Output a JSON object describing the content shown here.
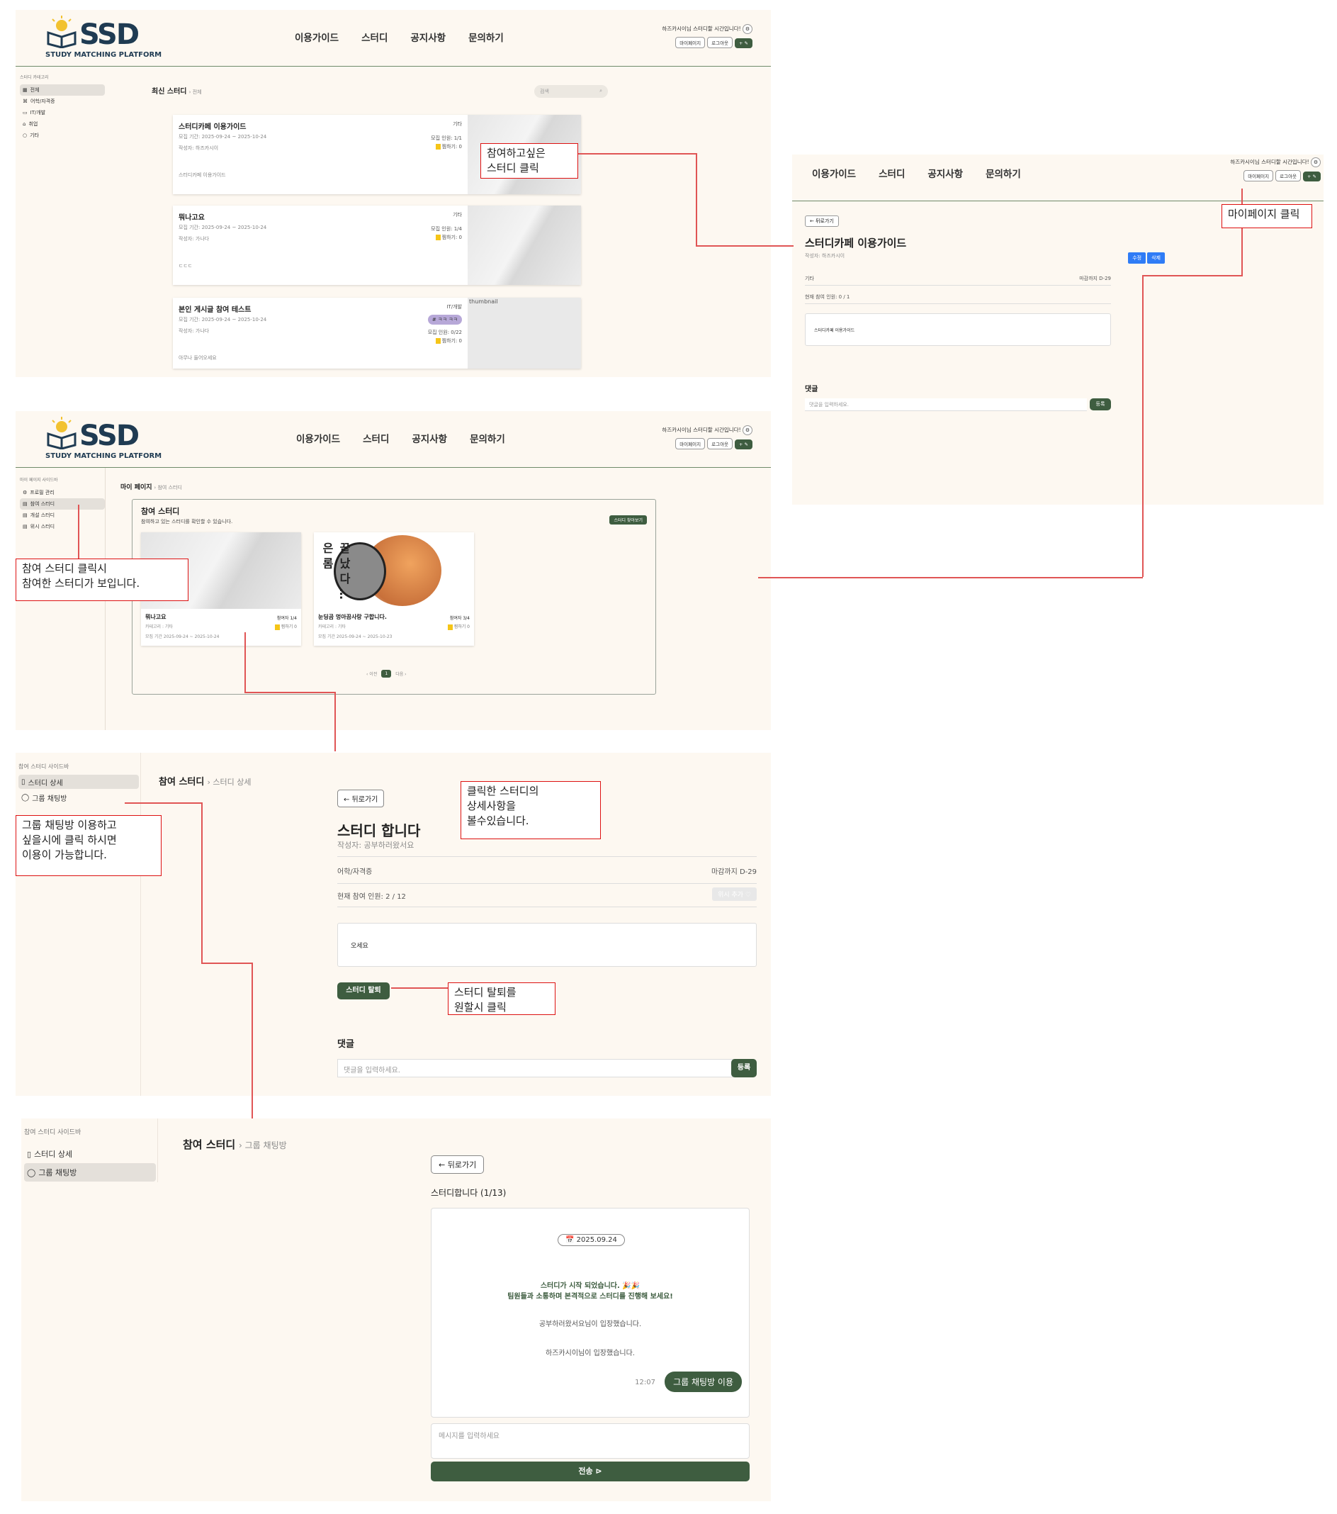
{
  "header": {
    "logo": "SSD",
    "logo_sub": "STUDY MATCHING PLATFORM",
    "nav": [
      "이용가이드",
      "스터디",
      "공지사항",
      "문의하기"
    ],
    "greeting": "하즈카시이님 스터디할 시간입니다!",
    "mypage": "마이페이지",
    "logout": "로그아웃",
    "write": "+ ✎"
  },
  "list_page": {
    "sidebar_title": "스터디 카테고리",
    "sidebar": [
      "전체",
      "어학/자격증",
      "IT/개발",
      "취업",
      "기타"
    ],
    "breadcrumb_main": "최신 스터디",
    "breadcrumb_sub": "전체",
    "search_placeholder": "검색",
    "cards": [
      {
        "title": "스터디카페 이용가이드",
        "period": "모집 기간: 2025-09-24 ~ 2025-10-24",
        "author": "작성자: 하즈카시이",
        "desc": "스터디카페 이용가이드",
        "category": "기타",
        "members": "모집 인원: 1/1",
        "likes": "찜하기: 0"
      },
      {
        "title": "뭐나고요",
        "period": "모집 기간: 2025-09-24 ~ 2025-10-24",
        "author": "작성자: 가나다",
        "desc": "ㄷㄷㄷ",
        "category": "기타",
        "members": "모집 인원: 1/4",
        "likes": "찜하기: 0"
      },
      {
        "title": "본인 게시글 참여 테스트",
        "period": "모집 기간: 2025-09-24 ~ 2025-10-24",
        "author": "작성자: 가나다",
        "desc": "아무나 들어오세요",
        "category": "IT/개발",
        "tag": "# ㅋㅋ ㅋㅋ",
        "members": "모집 인원: 0/22",
        "likes": "찜하기: 0",
        "thumb_alt": "thumbnail"
      }
    ]
  },
  "detail_page": {
    "back": "← 뒤로가기",
    "title": "스터디카페 이용가이드",
    "author": "작성자: 하즈카시이",
    "edit": "수정",
    "delete": "삭제",
    "category": "기타",
    "deadline": "마감까지 D-29",
    "members": "현재 참여 인원: 0 / 1",
    "content": "스터디카페 이용가이드",
    "comments_title": "댓글",
    "comment_placeholder": "댓글을 입력하세요.",
    "register": "등록"
  },
  "mypage": {
    "sidebar_title": "마이 페이지 사이드바",
    "sidebar": [
      "프로필 관리",
      "참여 스터디",
      "개설 스터디",
      "위시 스터디"
    ],
    "breadcrumb_main": "마이 페이지",
    "breadcrumb_sub": "참여 스터디",
    "section_title": "참여 스터디",
    "section_desc": "참여하고 있는 스터디를 확인할 수 있습니다.",
    "find_btn": "스터디 찾아보기",
    "cards": [
      {
        "title": "뭐나고요",
        "members": "참여자 1/4",
        "category": "카테고리 : 기타",
        "likes": "찜하기 0",
        "period": "모집 기간 2025-09-24 ~ 2025-10-24"
      },
      {
        "title": "눈딩곰 멍아끔사랑 구합니다.",
        "members": "참여자 3/4",
        "category": "카테고리 : 기타",
        "likes": "찜하기 0",
        "period": "모집 기간 2025-09-24 ~ 2025-10-23",
        "img_text": "끝 났 다 … 은 롬"
      }
    ],
    "pager_prev": "‹ 이전",
    "pager_current": "1",
    "pager_next": "다음 ›"
  },
  "joined_detail": {
    "sidebar_title": "참여 스터디 사이드바",
    "sidebar": [
      "스터디 상세",
      "그룹 채팅방"
    ],
    "breadcrumb_main": "참여 스터디",
    "breadcrumb_sub": "스터디 상세",
    "back": "← 뒤로가기",
    "title": "스터디 합니다",
    "author": "작성자: 공부하러왔서요",
    "category": "어학/자격증",
    "deadline": "마감까지 D-29",
    "members": "현재 참여 인원: 2 / 12",
    "wish_btn": "위시 추가 ♡",
    "content": "오세요",
    "leave_btn": "스터디 탈퇴",
    "comments_title": "댓글",
    "comment_placeholder": "댓글을 입력하세요.",
    "register": "등록"
  },
  "chat_page": {
    "sidebar_title": "참여 스터디 사이드바",
    "sidebar": [
      "스터디 상세",
      "그룹 채팅방"
    ],
    "breadcrumb_main": "참여 스터디",
    "breadcrumb_sub": "그룹 채팅방",
    "back": "← 뒤로가기",
    "room_title": "스터디합니다 (1/13)",
    "date_chip": "📅 2025.09.24",
    "system_line1": "스터디가 시작 되었습니다. 🎉🎉",
    "system_line2": "팀원들과 소통하며 본격적으로 스터디를 진행해 보세요!",
    "join1": "공부하러왔서요님이 입장했습니다.",
    "join2": "하즈카시이님이 입장했습니다.",
    "msg_time": "12:07",
    "msg_text": "그룹 채팅방 이용",
    "input_placeholder": "메시지를 입력하세요",
    "send": "전송 ⊳"
  },
  "annotations": {
    "click_study": "참여하고싶은\n스터디 클릭",
    "click_mypage": "마이페이지 클릭",
    "joined_list": "참여 스터디 클릭시\n참여한 스터디가 보입니다.",
    "detail_view": "클릭한 스터디의\n상세사항을\n볼수있습니다.",
    "chat_use": "그룹 채팅방 이용하고\n싶을시에 클릭 하시면\n이용이 가능합니다.",
    "leave": "스터디 탈퇴를\n원할시 클릭"
  },
  "colors": {
    "accent_green": "#3e5d40",
    "annotation_red": "#dd2222",
    "panel_bg": "#fdf8f1",
    "edit_blue": "#2f7cf6"
  }
}
